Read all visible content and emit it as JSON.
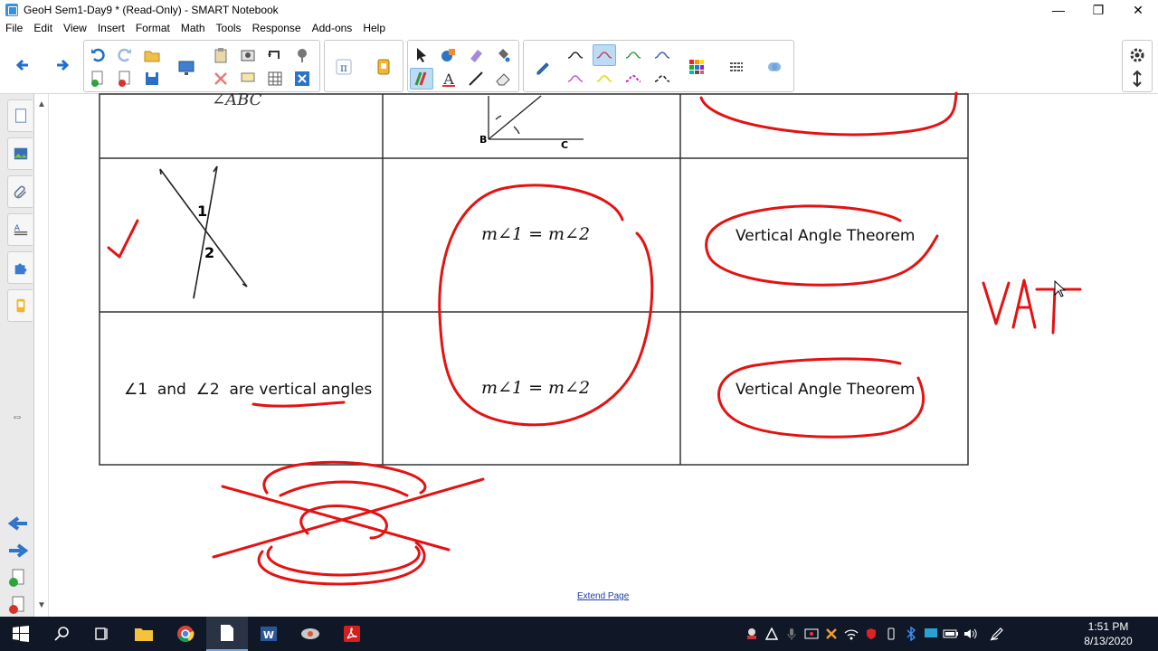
{
  "window": {
    "title": "GeoH Sem1-Day9 * (Read-Only) - SMART Notebook",
    "controls": {
      "minimize": "—",
      "restore": "❐",
      "close": "✕"
    }
  },
  "menu": [
    "File",
    "Edit",
    "View",
    "Insert",
    "Format",
    "Math",
    "Tools",
    "Response",
    "Add-ons",
    "Help"
  ],
  "toolbar": {
    "icons": [
      "back-arrow-icon",
      "forward-arrow-icon",
      "undo-icon",
      "redo-icon",
      "open-icon",
      "add-page-icon",
      "delete-page-icon",
      "save-icon",
      "screen-shade-icon",
      "paste-icon",
      "screen-capture-icon",
      "undo-clip-icon",
      "document-camera-icon",
      "delete-icon",
      "display-icon",
      "table-icon",
      "close-box-icon",
      "math-icon",
      "response-icon",
      "select-icon",
      "shapes-icon",
      "eraser-shapes-icon",
      "fill-icon",
      "pens-icon",
      "text-icon",
      "line-icon",
      "eraser-icon",
      "pen-tool-icon",
      "pen-styles-icon",
      "color-palette-icon",
      "line-style-icon",
      "properties-icon",
      "settings-icon",
      "move-toolbar-icon"
    ],
    "pen_colors": [
      "#222222",
      "#d23b5a",
      "#2f9a3e",
      "#3757c9",
      "#c94fbf",
      "#e5dd3a",
      "#d020c6",
      "#1a1a1a"
    ]
  },
  "content": {
    "row1": {
      "label": "∠ABC",
      "point_b": "B",
      "point_c": "C"
    },
    "row2": {
      "angle_1": "1",
      "angle_2": "2",
      "statement": "m∠1 = m∠2",
      "reason": "Vertical Angle Theorem"
    },
    "row3": {
      "given_prefix": "∠1  and  ∠2  are ",
      "given_emph": "vertical angles",
      "statement": "m∠1 = m∠2",
      "reason": "Vertical Angle Theorem"
    },
    "annotation": "VAT",
    "extend_link": "Extend Page"
  },
  "ink": {
    "red": "#e41212"
  },
  "taskbar": {
    "time": "1:51 PM",
    "date": "8/13/2020"
  }
}
